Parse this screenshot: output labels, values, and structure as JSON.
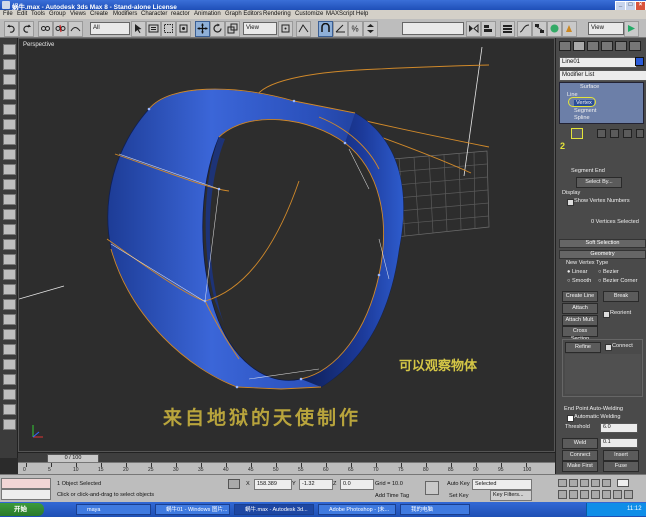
{
  "titlebar": {
    "title": "蜗牛.max - Autodesk 3ds Max 8 - Stand-alone License"
  },
  "menu": [
    "File",
    "Edit",
    "Tools",
    "Group",
    "Views",
    "Create",
    "Modifiers",
    "Character",
    "reactor",
    "Animation",
    "Graph Editors",
    "Rendering",
    "Customize",
    "MAXScript",
    "Help"
  ],
  "toolbar": {
    "selection_filter": "All",
    "ref_coord": "View",
    "named_sets": "",
    "render_view": "View"
  },
  "viewport": {
    "label": "Perspective",
    "annotation1": "可以观察物体",
    "annotation2": "来自地狱的天使制作"
  },
  "command_panel": {
    "object_name": "Line01",
    "modifier_list": "Modifier List",
    "stack": {
      "surface": "Surface",
      "line": "Line",
      "vertex": "Vertex",
      "segment": "Segment",
      "spline": "Spline"
    },
    "step_number": "2",
    "segment_end": "Segment End",
    "select_by": "Select By...",
    "display_label": "Display",
    "show_vertex_numbers": "Show Vertex Numbers",
    "vertices_selected": "0 Vertices Selected",
    "soft_selection": "Soft Selection",
    "geometry": "Geometry",
    "new_vertex_type": "New Vertex Type",
    "vtype_linear": "Linear",
    "vtype_bezier": "Bezier",
    "vtype_smooth": "Smooth",
    "vtype_bezier_corner": "Bezier Corner",
    "create_line": "Create Line",
    "break": "Break",
    "attach": "Attach",
    "reorient": "Reorient",
    "attach_mult": "Attach Mult.",
    "cross_section": "Cross Section",
    "refine": "Refine",
    "connect": "Connect",
    "end_point_auto_welding": "End Point Auto-Welding",
    "automatic_welding": "Automatic Welding",
    "threshold_label": "Threshold",
    "threshold_value": "6.0",
    "weld": "Weld",
    "weld_value": "0.1",
    "connect_btn": "Connect",
    "insert": "Insert",
    "make_first": "Make First",
    "fuse": "Fuse"
  },
  "timeline": {
    "frame_display": "0 / 100",
    "ticks": [
      "0",
      "5",
      "10",
      "15",
      "20",
      "25",
      "30",
      "35",
      "40",
      "45",
      "50",
      "55",
      "60",
      "65",
      "70",
      "75",
      "80",
      "85",
      "90",
      "95",
      "100"
    ]
  },
  "status": {
    "listener": "",
    "selection_info": "1 Object Selected",
    "prompt": "Click or click-and-drag to select objects",
    "x_value": "158.389",
    "y_value": "-1.32",
    "z_value": "0.0",
    "grid": "Grid = 10.0",
    "add_time_tag": "Add Time Tag",
    "auto_key": "Auto Key",
    "set_key": "Set Key",
    "selected": "Selected",
    "key_filters": "Key Filters..."
  },
  "taskbar": {
    "start": "开始",
    "tasks": [
      "maya",
      "蜗牛01 - Windows 图片...",
      "蜗牛.max - Autodesk 3d...",
      "Adobe Photoshop - [未...",
      "我的电脑"
    ],
    "clock": "11:12"
  },
  "colors": {
    "mesh": "#2a55c8",
    "spline": "#d0892a",
    "annotation": "#d4c646",
    "annotation2": "#b8a43c"
  }
}
